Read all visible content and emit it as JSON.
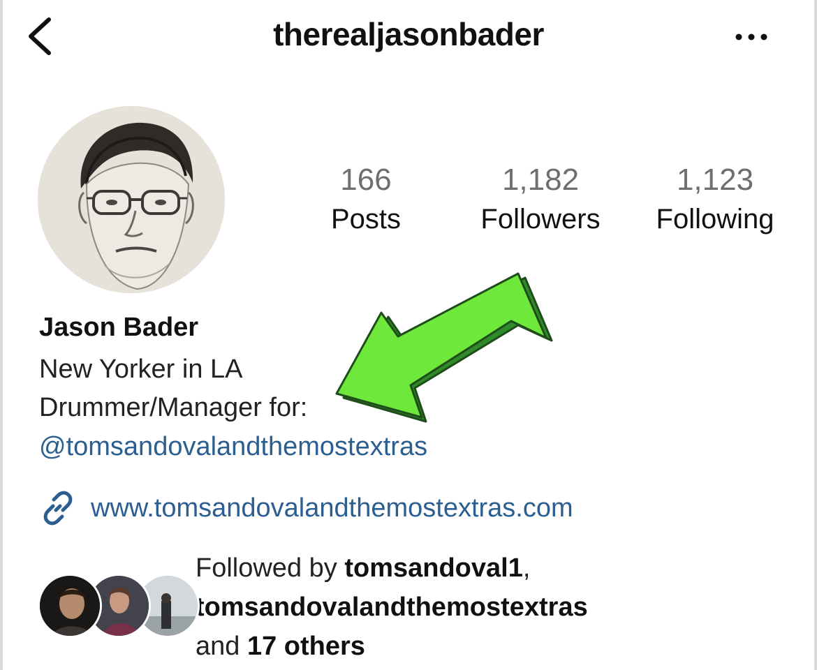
{
  "header": {
    "username": "therealjasonbader",
    "back_icon": "chevron-left-icon",
    "more_icon": "more-horizontal-icon"
  },
  "stats": {
    "posts": {
      "count": "166",
      "label": "Posts"
    },
    "followers": {
      "count": "1,182",
      "label": "Followers"
    },
    "following": {
      "count": "1,123",
      "label": "Following"
    }
  },
  "bio": {
    "name": "Jason Bader",
    "line1": "New Yorker in LA",
    "line2": "Drummer/Manager for:",
    "mention": "@tomsandovalandthemostextras",
    "link_icon": "link-icon",
    "website": "www.tomsandovalandthemostextras.com"
  },
  "followed_by": {
    "prefix": "Followed by ",
    "user1": "tomsandoval1",
    "separator": ",",
    "user2": "tomsandovalandthemostextras",
    "and": "and ",
    "others": "17 others"
  },
  "annotation": {
    "arrow_color": "#6ee83a",
    "arrow_shadow_color": "#2f8a2a"
  },
  "colors": {
    "link": "#2b5e91",
    "count_gray": "#6e6e6e"
  }
}
